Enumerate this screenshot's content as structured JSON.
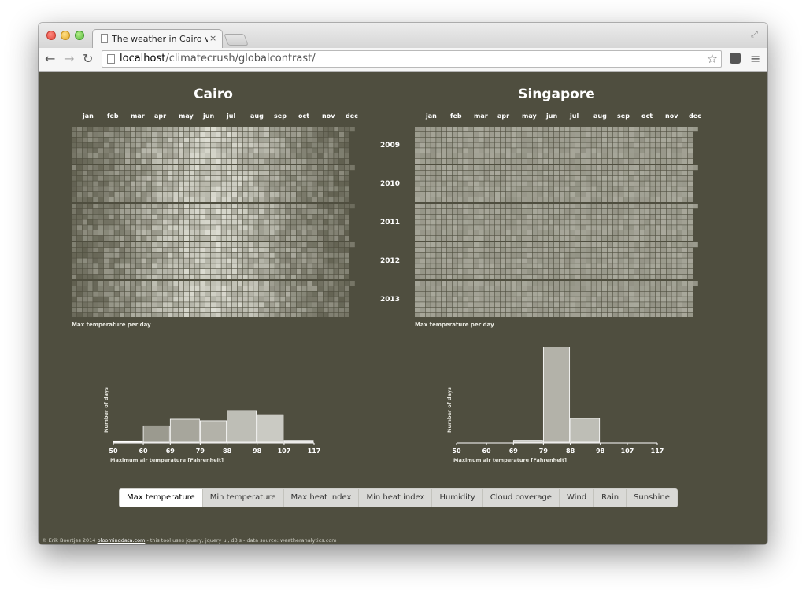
{
  "browser": {
    "tab_title": "The weather in Cairo vs Singapore",
    "tab_close": "×",
    "url_host": "localhost",
    "url_path": "/climatecrush/globalcontrast/"
  },
  "page": {
    "cities": [
      "Cairo",
      "Singapore"
    ],
    "months": [
      "jan",
      "feb",
      "mar",
      "apr",
      "may",
      "jun",
      "jul",
      "aug",
      "sep",
      "oct",
      "nov",
      "dec"
    ],
    "years": [
      "2009",
      "2010",
      "2011",
      "2012",
      "2013"
    ],
    "grid_caption": "Max temperature per day",
    "footer": {
      "prefix": "© Erik Boertjes 2014 ",
      "link": "bloomingdata.com",
      "suffix": " - this tool uses jquery, jquery ui, d3js - data source: weatheranalytics.com"
    }
  },
  "chart_data": [
    {
      "type": "bar",
      "title": "",
      "xlabel": "Maximum air temperature [Fahrenheit]",
      "ylabel": "Number of days",
      "x_ticks": [
        50,
        60,
        69,
        79,
        88,
        98,
        107,
        117
      ],
      "bins": [
        [
          50,
          60
        ],
        [
          60,
          69
        ],
        [
          69,
          79
        ],
        [
          79,
          88
        ],
        [
          88,
          98
        ],
        [
          98,
          107
        ],
        [
          107,
          117
        ]
      ],
      "values": [
        1,
        32,
        45,
        42,
        62,
        54,
        2
      ]
    },
    {
      "type": "bar",
      "title": "",
      "xlabel": "Maximum air temperature [Fahrenheit]",
      "ylabel": "Number of days",
      "x_ticks": [
        50,
        60,
        69,
        79,
        88,
        98,
        107,
        117
      ],
      "bins": [
        [
          50,
          60
        ],
        [
          60,
          69
        ],
        [
          69,
          79
        ],
        [
          79,
          88
        ],
        [
          88,
          98
        ],
        [
          98,
          107
        ],
        [
          107,
          117
        ]
      ],
      "values": [
        0,
        0,
        2,
        187,
        44,
        0,
        0
      ]
    }
  ],
  "metric_buttons": {
    "labels": [
      "Max temperature",
      "Min temperature",
      "Max heat index",
      "Min heat index",
      "Humidity",
      "Cloud coverage",
      "Wind",
      "Rain",
      "Sunshine"
    ],
    "active": 0
  },
  "colors": {
    "page_background": "#4f4e3f",
    "heat_cold": "#5d5c4c",
    "heat_hot": "#e6e6dc",
    "bar_fill_light": "#d6d6d0",
    "bar_fill_dark": "#8f8e82"
  }
}
